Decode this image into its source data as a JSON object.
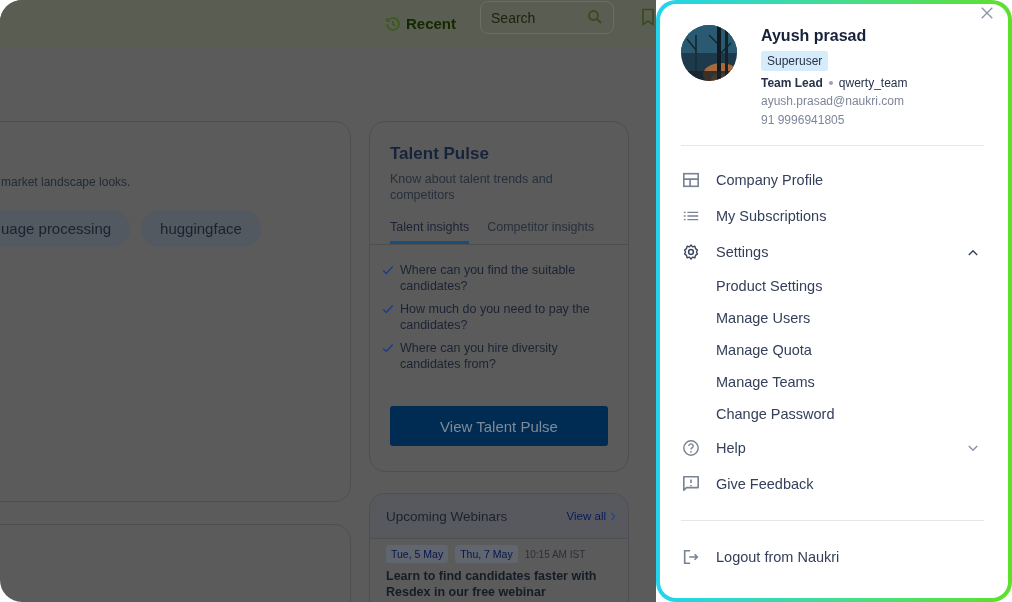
{
  "header": {
    "recent": "Recent",
    "search": {
      "placeholder": "Search"
    }
  },
  "market_card": {
    "intro": "market landscape looks.",
    "chips": [
      "uage processing",
      "huggingface"
    ]
  },
  "talent_pulse": {
    "title": "Talent Pulse",
    "subtitle": "Know about talent trends and competitors",
    "tabs": [
      {
        "label": "Talent insights",
        "selected": true
      },
      {
        "label": "Competitor insights",
        "selected": false
      }
    ],
    "checklist": [
      "Where can you find the suitable candidates?",
      "How much do you need to pay the candidates?",
      "Where can you hire diversity candidates from?"
    ],
    "button": "View Talent Pulse"
  },
  "webinars": {
    "title": "Upcoming Webinars",
    "view_all": "View all",
    "dates": [
      "Tue, 5 May",
      "Thu, 7 May"
    ],
    "time": "10:15 AM IST",
    "headline": "Learn to find candidates faster with Resdex in our free webinar"
  },
  "profile_panel": {
    "name": "Ayush prasad",
    "badge": "Superuser",
    "role": "Team Lead",
    "team": "qwerty_team",
    "email": "ayush.prasad@naukri.com",
    "phone": "91 9996941805",
    "menu": [
      {
        "label": "Company Profile",
        "kind": "layout"
      },
      {
        "label": "My Subscriptions",
        "kind": "list"
      },
      {
        "label": "Settings",
        "kind": "gear",
        "expanded": true,
        "children": [
          {
            "label": "Product Settings"
          },
          {
            "label": "Manage Users"
          },
          {
            "label": "Manage Quota"
          },
          {
            "label": "Manage Teams"
          },
          {
            "label": "Change Password"
          }
        ]
      },
      {
        "label": "Help",
        "kind": "help",
        "expanded": false
      },
      {
        "label": "Give Feedback",
        "kind": "feedback"
      }
    ],
    "logout": "Logout from Naukri"
  }
}
